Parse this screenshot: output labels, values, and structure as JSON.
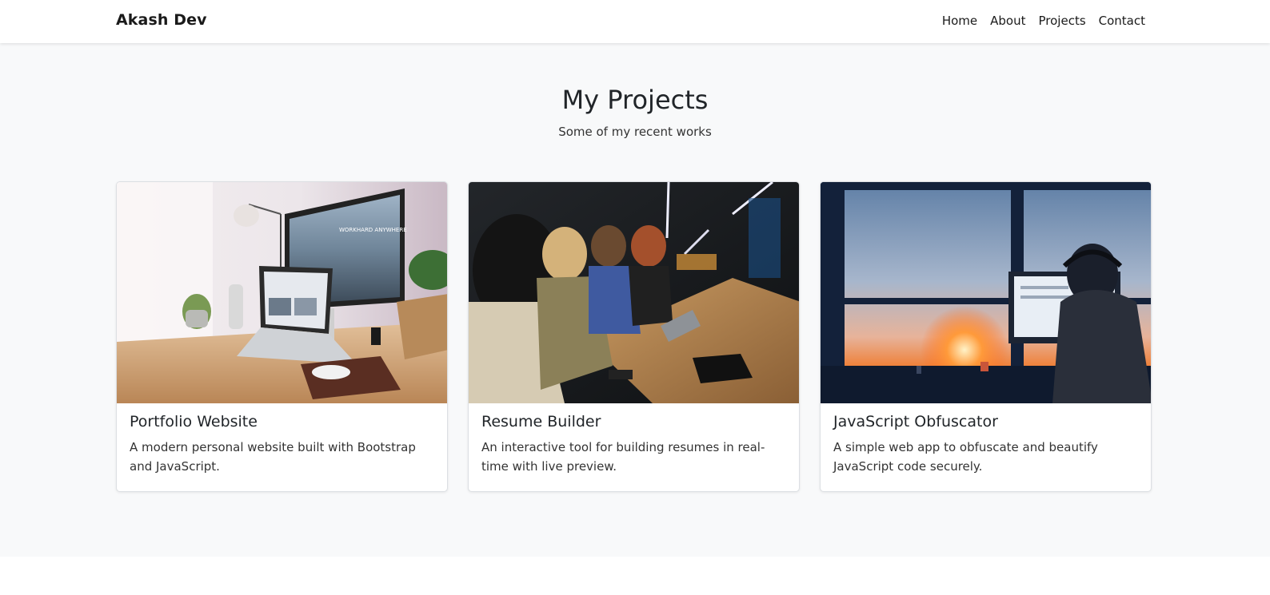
{
  "navbar": {
    "brand": "Akash Dev",
    "links": [
      "Home",
      "About",
      "Projects",
      "Contact"
    ]
  },
  "projects_section": {
    "title": "My Projects",
    "subtitle": "Some of my recent works",
    "cards": [
      {
        "title": "Portfolio Website",
        "description": "A modern personal website built with Bootstrap and JavaScript.",
        "image": "desk-workspace-photo",
        "image_text": "WORKHARD ANYWHERE"
      },
      {
        "title": "Resume Builder",
        "description": "An interactive tool for building resumes in real-time with live preview.",
        "image": "team-meeting-photo"
      },
      {
        "title": "JavaScript Obfuscator",
        "description": "A simple web app to obfuscate and beautify JavaScript code securely.",
        "image": "sunset-developer-photo"
      }
    ]
  },
  "colors": {
    "section_bg": "#f8f9fa",
    "navbar_bg": "#ffffff",
    "text": "#212529"
  }
}
